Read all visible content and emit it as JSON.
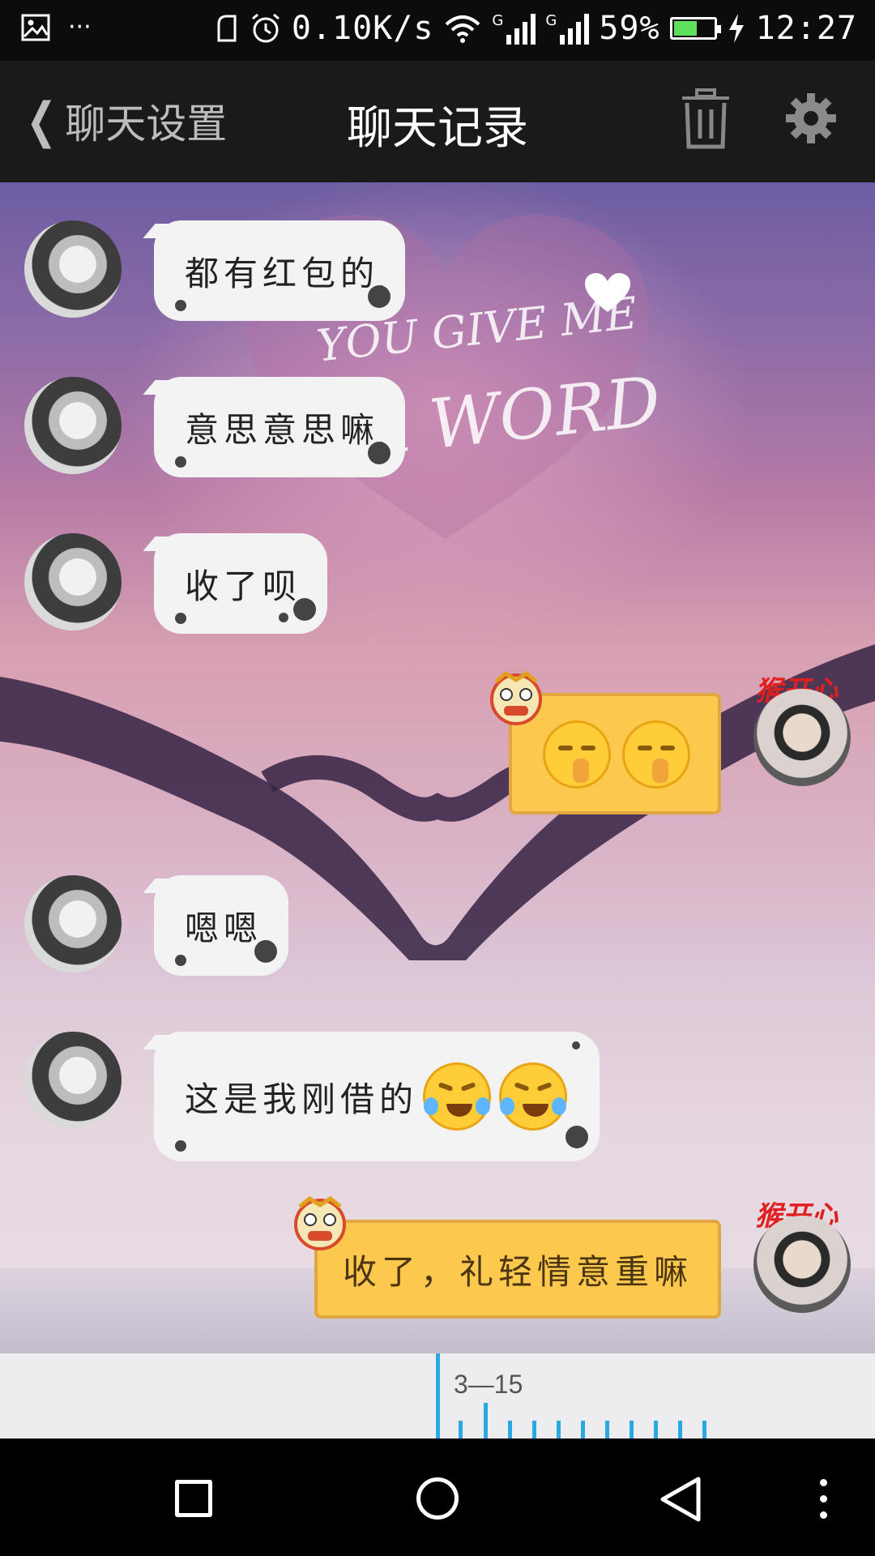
{
  "status_bar": {
    "net_speed": "0.10K/s",
    "sim1_label": "G",
    "sim2_label": "G",
    "battery_percent": "59%",
    "battery_level": 0.59,
    "time": "12:27",
    "overflow": "···",
    "icons": [
      "gallery-icon",
      "more-icon",
      "alarm-icon",
      "wifi-icon",
      "signal-icon",
      "battery-icon",
      "charging-icon"
    ]
  },
  "header": {
    "back_label": "聊天设置",
    "title": "聊天记录",
    "delete_icon": "trash-icon",
    "settings_icon": "gear-icon"
  },
  "background_text": {
    "line1": "YOU GIVE ME",
    "line2": "R WORD"
  },
  "messages": [
    {
      "sender": "other",
      "text": "都有红包的"
    },
    {
      "sender": "other",
      "text": "意思意思嘛"
    },
    {
      "sender": "other",
      "text": "收了呗"
    },
    {
      "sender": "me",
      "text": "",
      "emojis": [
        "shy-emoji",
        "shy-emoji"
      ]
    },
    {
      "sender": "other",
      "text": "嗯嗯"
    },
    {
      "sender": "other",
      "text": "这是我刚借的",
      "emojis": [
        "tears-of-joy-emoji",
        "tears-of-joy-emoji"
      ]
    },
    {
      "sender": "me",
      "text": "收了，礼轻情意重嘛"
    }
  ],
  "avatar_badge_text": "猴开心",
  "timeline": {
    "date_label": "3—15"
  },
  "nav_bar": {
    "icons": [
      "recents-icon",
      "home-icon",
      "back-icon",
      "menu-icon"
    ]
  },
  "colors": {
    "my_bubble": "#fcc84e",
    "other_bubble": "#f3f3f3",
    "timeline_accent": "#2aa9e0"
  }
}
